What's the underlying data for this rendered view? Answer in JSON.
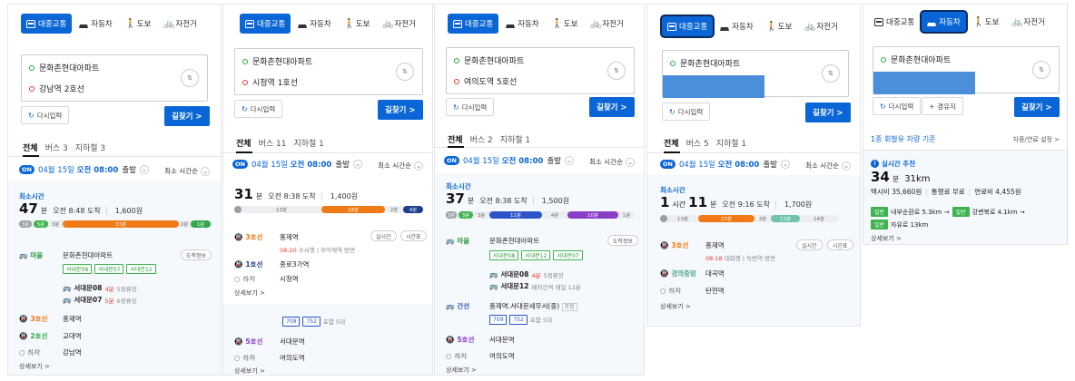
{
  "modes": {
    "transit": "대중교통",
    "car": "자동차",
    "walk": "도보",
    "bike": "자전거"
  },
  "common": {
    "reset": "다시입력",
    "waypoint": "경유지",
    "go": "길찾기 >",
    "swap": "⇅",
    "on_badge": "ON",
    "date": "04월 15일",
    "time": "오전 08:00",
    "depart": "출발",
    "sort": "최소 시간순",
    "fastest": "최소시간",
    "minute": "분",
    "hour": "시간",
    "detail": "상세보기 >",
    "realtime": "실시간",
    "schedule": "시간표",
    "arrive_info": "도착정보",
    "getoff": "하차",
    "origin": "문화촌현대아파트"
  },
  "panels": [
    {
      "dest": "강남역 2호선",
      "tabs": [
        "전체",
        "버스 3",
        "지하철 3"
      ],
      "duration_min": "47",
      "arrive": "오전 8:48 도착",
      "fare": "1,600원",
      "bar": [
        "3분",
        "5분",
        "3분",
        "33분",
        "2분",
        "1분"
      ],
      "steps": {
        "s1_mode": "마을",
        "s1_name": "문화촌현대아파트",
        "s1_chips": [
          "서대문08",
          "서대문07",
          "서대문12"
        ],
        "bus_a": "서대문08",
        "bus_a_time": "4분",
        "bus_a_stop": "5정류장",
        "bus_b": "서대문07",
        "bus_b_time": "5분",
        "bus_b_stop": "6정류장",
        "s2_mode": "3호선",
        "s2_name": "홍제역",
        "s3_mode": "2호선",
        "s3_name": "교대역",
        "s4_name": "강남역"
      }
    },
    {
      "dest": "시청역 1호선",
      "tabs": [
        "전체",
        "버스 11",
        "지하철 1"
      ],
      "duration_min": "31",
      "arrive": "오전 8:38 도착",
      "fare": "1,400원",
      "bar": [
        "13분",
        "18분",
        "2분",
        "4분"
      ],
      "steps": {
        "s1_mode": "3호선",
        "s1_name": "홍제역",
        "s1_sub_time": "08:20",
        "s1_sub": "수서행 | 무악재역 방면",
        "s2_mode": "1호선",
        "s2_name": "종로3가역",
        "s3_name": "시청역",
        "ext_mode": "5호선",
        "ext_name": "서대문역",
        "ext_chips": [
          "709",
          "752"
        ],
        "ext_more": "포함 5대",
        "ext_end": "여의도역"
      }
    },
    {
      "dest": "여의도역 5호선",
      "tabs": [
        "전체",
        "버스 2",
        "지하철 1"
      ],
      "duration_min": "37",
      "arrive": "오전 8:38 도착",
      "fare": "1,500원",
      "bar": [
        "3분",
        "3분",
        "3분",
        "11분",
        "4분",
        "10분",
        "1분"
      ],
      "steps": {
        "s1_mode": "마을",
        "s1_name": "문화촌현대아파트",
        "s1_chips": [
          "서대문08",
          "서대문12",
          "서대문07"
        ],
        "bus_a": "서대문08",
        "bus_a_time": "4분",
        "bus_a_stop": "5정류장",
        "bus_b": "서대문12",
        "bus_b_sub": "배차간격 매일 12분",
        "s2_mode": "간선",
        "s2_name": "홍제역.서대문세무서(중)",
        "s2_tag": "포함",
        "s2_chips": [
          "709",
          "752"
        ],
        "s2_more": "포함 5대",
        "s3_mode": "5호선",
        "s3_name": "서대문역",
        "s4_name": "여의도역"
      }
    },
    {
      "dest_masked": true,
      "tabs": [
        "전체",
        "버스 5",
        "지하철 1"
      ],
      "duration_h": "1",
      "duration_min": "11",
      "arrive": "오전 9:16 도착",
      "fare": "1,700원",
      "bar": [
        "13분",
        "27분",
        "3분",
        "12분",
        "14분"
      ],
      "steps": {
        "s1_mode": "3호선",
        "s1_name": "홍제역",
        "s1_sub_time": "08:18",
        "s1_sub": "대화행 | 녹번역 방면",
        "s2_mode": "경의중앙",
        "s2_name": "대곡역",
        "s3_name": "탄현역"
      }
    },
    {
      "dest_masked": true,
      "car_title": "1종 휘발유 차량 기준",
      "car_setting": "차종/연료 설정 >",
      "realtime_label": "실시간 추천",
      "duration_min": "34",
      "distance": "31km",
      "taxi": "택시비 35,660원",
      "toll": "통행료 무료",
      "fuel": "연료비 4,455원",
      "road1_tag": "일반",
      "road1": "내부순환로 5.3km →",
      "road2_tag": "일반",
      "road2": "강변북로 4.1km →",
      "road3_tag": "일반",
      "road3": "자유로 13km"
    }
  ],
  "colors": {
    "blue": "#0a66d6",
    "green": "#3fb34f",
    "orange": "#f07a16",
    "line2": "#32a84a",
    "line1": "#1d3d8f",
    "line5": "#8a3ec5",
    "trunk": "#2b54c9",
    "red": "#e63c32"
  }
}
